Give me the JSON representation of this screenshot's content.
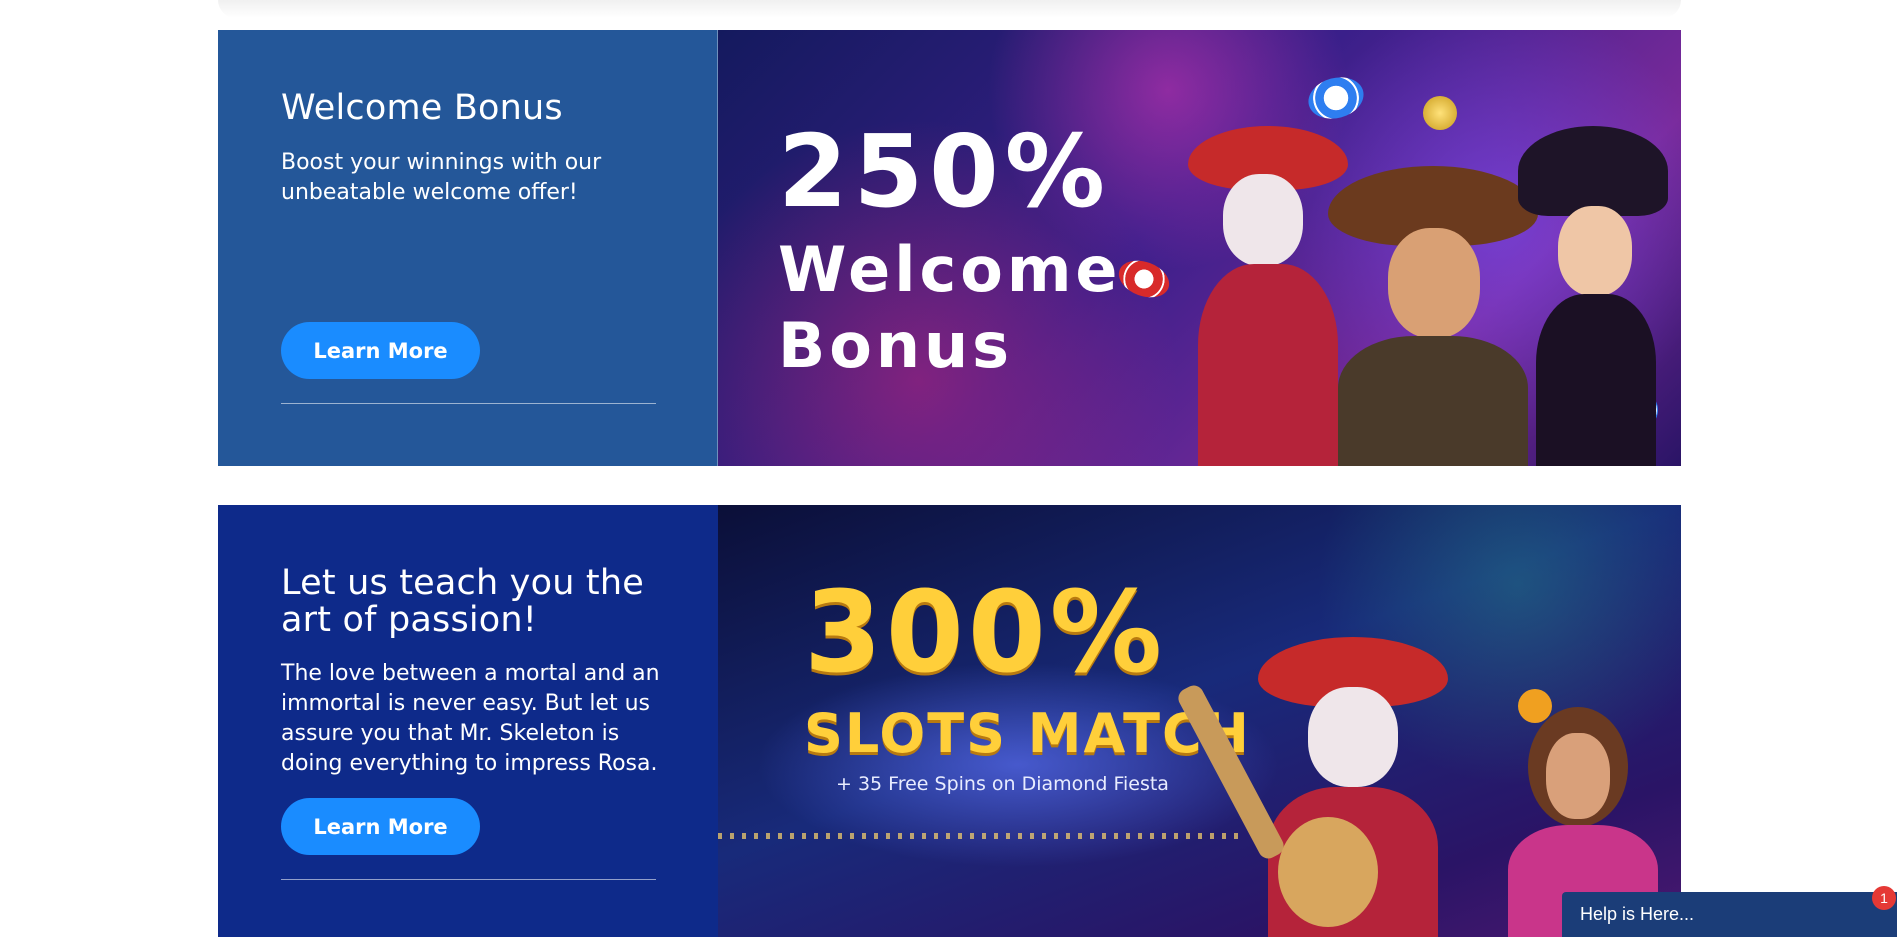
{
  "promos": [
    {
      "title": "Welcome Bonus",
      "description": "Boost your winnings with our unbeatable welcome offer!",
      "button_label": "Learn More",
      "banner": {
        "headline": "250%",
        "line1": "Welcome",
        "line2": "Bonus"
      }
    },
    {
      "title": "Let us teach you the art of passion!",
      "description": "The love between a mortal and an immortal is never easy. But let us assure you that Mr. Skeleton is doing everything to impress Rosa.",
      "button_label": "Learn More",
      "banner": {
        "headline": "300%",
        "line1": "SLOTS MATCH",
        "line2": "+ 35 Free Spins on Diamond Fiesta"
      }
    }
  ],
  "chat": {
    "label": "Help is Here...",
    "badge_count": "1"
  },
  "colors": {
    "promo1_panel": "#245799",
    "promo2_panel": "#0e2a8a",
    "button": "#1a8cff",
    "chat_bar": "#1b3d78",
    "badge": "#e53935"
  }
}
